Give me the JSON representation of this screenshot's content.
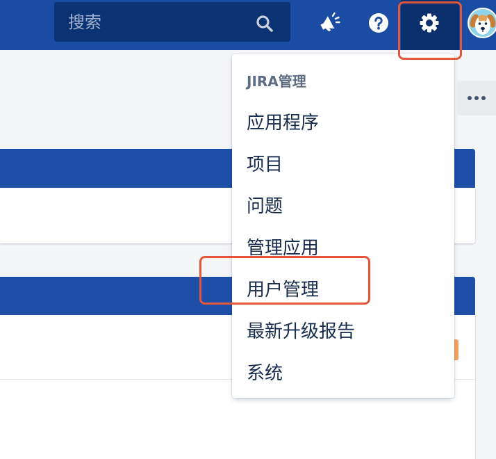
{
  "header": {
    "search": {
      "placeholder": "搜索",
      "icon": "search-icon"
    },
    "whats_new": {
      "icon": "megaphone-icon"
    },
    "help": {
      "icon": "help-icon"
    },
    "settings": {
      "icon": "gear-icon"
    },
    "profile": {
      "icon": "avatar"
    }
  },
  "toolbar": {
    "more": {
      "icon": "more-icon"
    }
  },
  "admin_menu": {
    "heading": "JIRA管理",
    "items": [
      {
        "label": "应用程序"
      },
      {
        "label": "项目"
      },
      {
        "label": "问题"
      },
      {
        "label": "管理应用"
      },
      {
        "label": "用户管理"
      },
      {
        "label": "最新升级报告"
      },
      {
        "label": "系统"
      }
    ]
  },
  "colors": {
    "header_blue": "#1b4ca4",
    "search_bg": "#0b3272",
    "settings_active_bg": "#0a2f6c",
    "panel_blue": "#1d4fa8",
    "page_bg": "#f4f5f7",
    "menu_text": "#172b4d",
    "menu_heading": "#5e6c84",
    "annotation_red": "#e4553a",
    "orange_accent": "#f5a25a"
  }
}
